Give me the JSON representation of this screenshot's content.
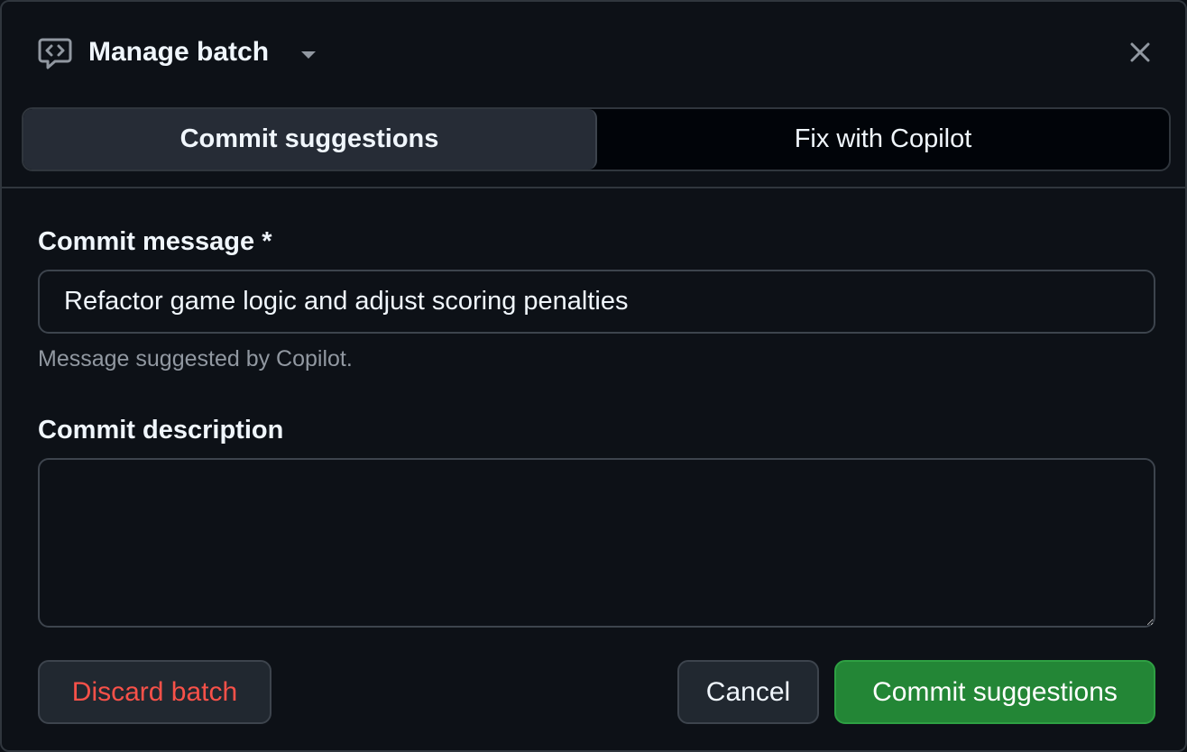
{
  "header": {
    "title": "Manage batch",
    "icon": "code-review-icon",
    "close_icon": "close-icon"
  },
  "tabs": [
    {
      "label": "Commit suggestions",
      "active": true
    },
    {
      "label": "Fix with Copilot",
      "active": false
    }
  ],
  "form": {
    "commit_message_label": "Commit message *",
    "commit_message_value": "Refactor game logic and adjust scoring penalties",
    "commit_message_hint": "Message suggested by Copilot.",
    "commit_description_label": "Commit description",
    "commit_description_value": ""
  },
  "actions": {
    "discard_label": "Discard batch",
    "cancel_label": "Cancel",
    "commit_label": "Commit suggestions"
  },
  "colors": {
    "background": "#0d1117",
    "danger": "#f85149",
    "primary": "#238636"
  }
}
